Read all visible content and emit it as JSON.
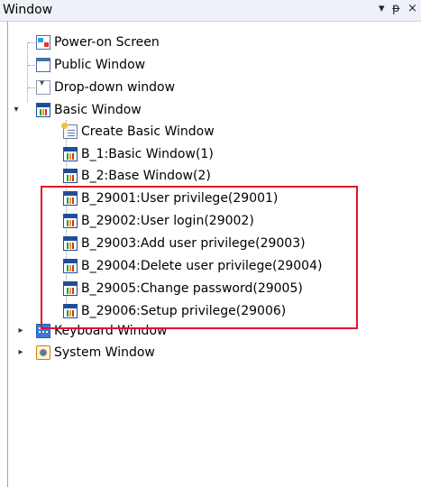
{
  "panel": {
    "title": "Window",
    "dropdown_glyph": "▾",
    "pin_glyph": "ᵽ",
    "close_glyph": "×"
  },
  "tree": {
    "items": [
      {
        "label": "Power-on Screen",
        "icon": "power-on-screen-icon"
      },
      {
        "label": "Public Window",
        "icon": "window-icon"
      },
      {
        "label": "Drop-down window",
        "icon": "dropdown-window-icon"
      },
      {
        "label": "Basic Window",
        "icon": "basic-window-icon",
        "expanded": true,
        "children": [
          {
            "label": "Create Basic Window",
            "icon": "create-window-icon"
          },
          {
            "label": "B_1:Basic Window(1)",
            "icon": "basic-window-icon"
          },
          {
            "label": "B_2:Base Window(2)",
            "icon": "basic-window-icon"
          },
          {
            "label": "B_29001:User privilege(29001)",
            "icon": "basic-window-icon"
          },
          {
            "label": "B_29002:User login(29002)",
            "icon": "basic-window-icon"
          },
          {
            "label": "B_29003:Add user privilege(29003)",
            "icon": "basic-window-icon"
          },
          {
            "label": "B_29004:Delete user privilege(29004)",
            "icon": "basic-window-icon"
          },
          {
            "label": "B_29005:Change password(29005)",
            "icon": "basic-window-icon"
          },
          {
            "label": "B_29006:Setup privilege(29006)",
            "icon": "basic-window-icon"
          }
        ]
      },
      {
        "label": "Keyboard Window",
        "icon": "keyboard-window-icon",
        "expanded": false
      },
      {
        "label": "System Window",
        "icon": "system-window-icon",
        "expanded": false
      }
    ]
  },
  "colors": {
    "highlight_border": "#e0142b",
    "titlebar_bg": "#eef2f8"
  }
}
